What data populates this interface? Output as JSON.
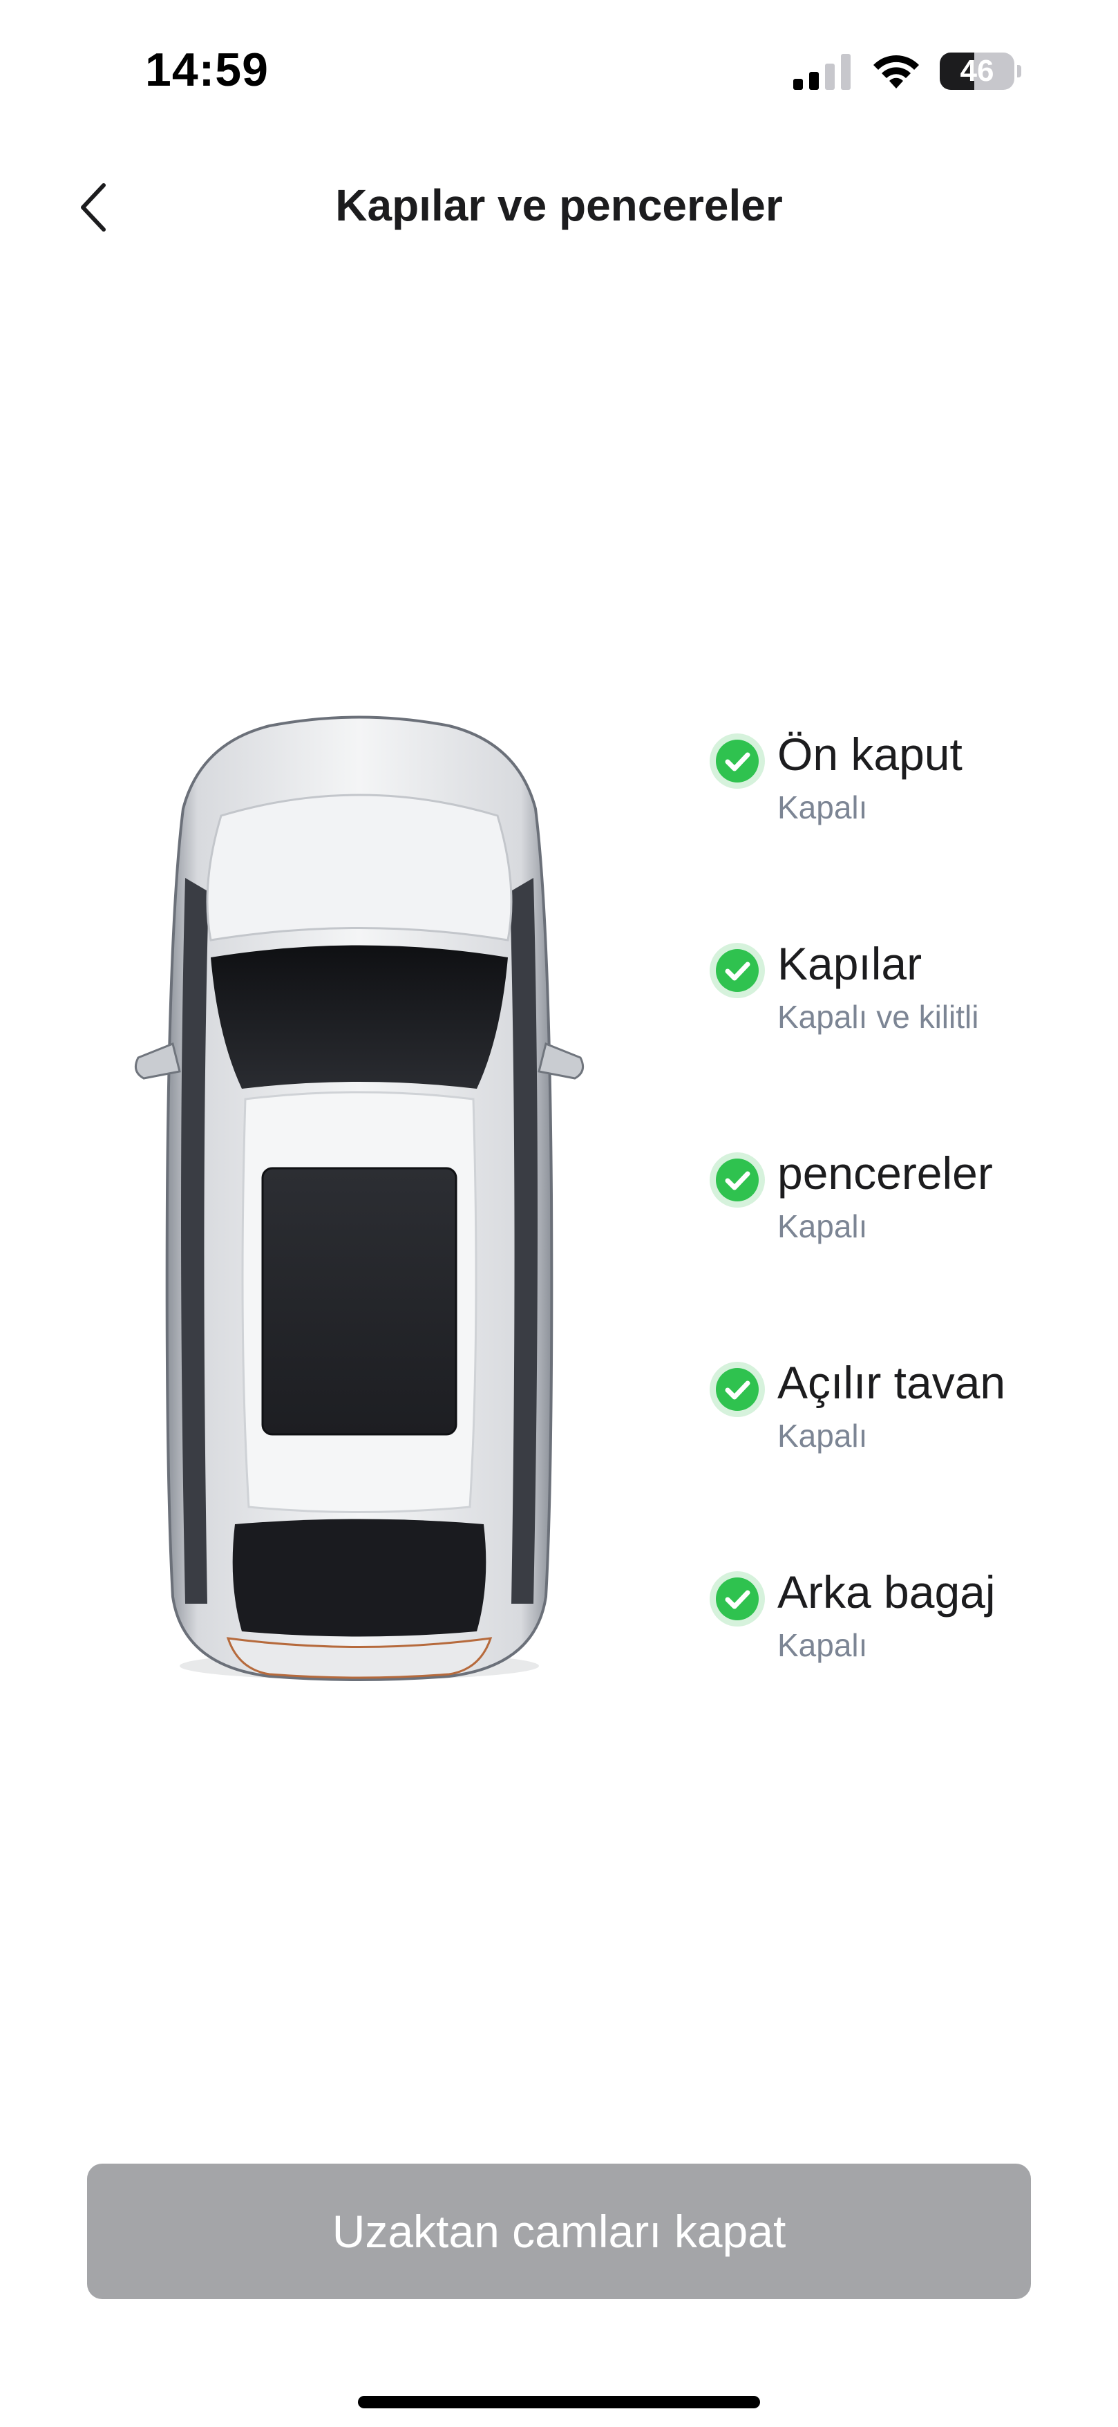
{
  "status_bar": {
    "time": "14:59",
    "signal_icon": "cellular-signal-icon",
    "wifi_icon": "wifi-icon",
    "battery_level": 46,
    "battery_text": "46"
  },
  "header": {
    "back_icon": "chevron-left-icon",
    "title": "Kapılar ve pencereler"
  },
  "car": {
    "icon": "car-top-view-illustration",
    "body_color": "#f1f2f4",
    "glass_color": "#1b1c20"
  },
  "status_items": [
    {
      "name": "Ön kaput",
      "status": "Kapalı",
      "icon": "check-circle-icon"
    },
    {
      "name": "Kapılar",
      "status": "Kapalı ve kilitli",
      "icon": "check-circle-icon"
    },
    {
      "name": "pencereler",
      "status": "Kapalı",
      "icon": "check-circle-icon"
    },
    {
      "name": "Açılır tavan",
      "status": "Kapalı",
      "icon": "check-circle-icon"
    },
    {
      "name": "Arka bagaj",
      "status": "Kapalı",
      "icon": "check-circle-icon"
    }
  ],
  "action": {
    "label": "Uzaktan camları kapat",
    "state": "disabled"
  },
  "colors": {
    "check_green": "#2fc24f",
    "check_ring": "#d6f2dc",
    "button_disabled": "#a4a5a8",
    "secondary_text": "#7c8594"
  }
}
